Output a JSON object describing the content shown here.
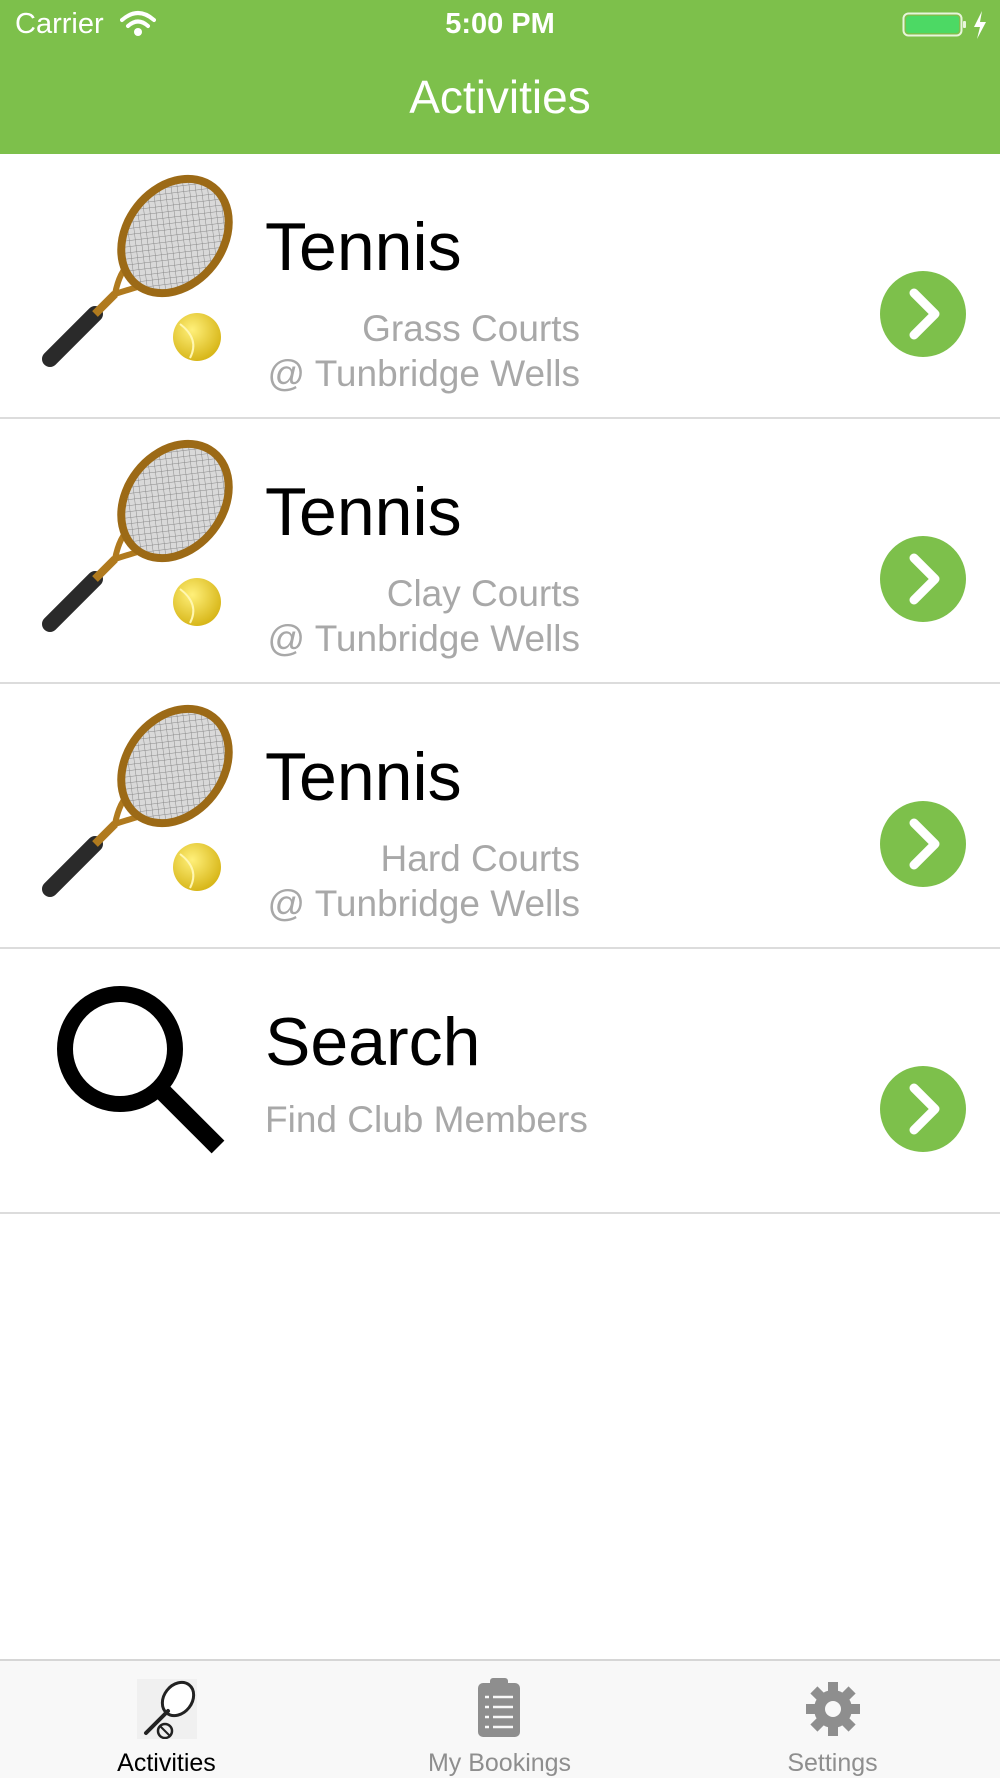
{
  "status_bar": {
    "carrier": "Carrier",
    "time": "5:00 PM",
    "battery_color": "#4cd964"
  },
  "nav": {
    "title": "Activities"
  },
  "accent_color": "#7dc04b",
  "activities": [
    {
      "icon": "tennis-racket-icon",
      "title": "Tennis",
      "line1": "Grass Courts",
      "line2": "@ Tunbridge Wells"
    },
    {
      "icon": "tennis-racket-icon",
      "title": "Tennis",
      "line1": "Clay Courts",
      "line2": "@ Tunbridge Wells"
    },
    {
      "icon": "tennis-racket-icon",
      "title": "Tennis",
      "line1": "Hard Courts",
      "line2": "@ Tunbridge Wells"
    },
    {
      "icon": "search-icon",
      "title": "Search",
      "line1": "Find Club Members"
    }
  ],
  "tabs": [
    {
      "label": "Activities",
      "icon": "tennis-racket-icon",
      "active": true
    },
    {
      "label": "My Bookings",
      "icon": "clipboard-icon",
      "active": false
    },
    {
      "label": "Settings",
      "icon": "gear-icon",
      "active": false
    }
  ]
}
